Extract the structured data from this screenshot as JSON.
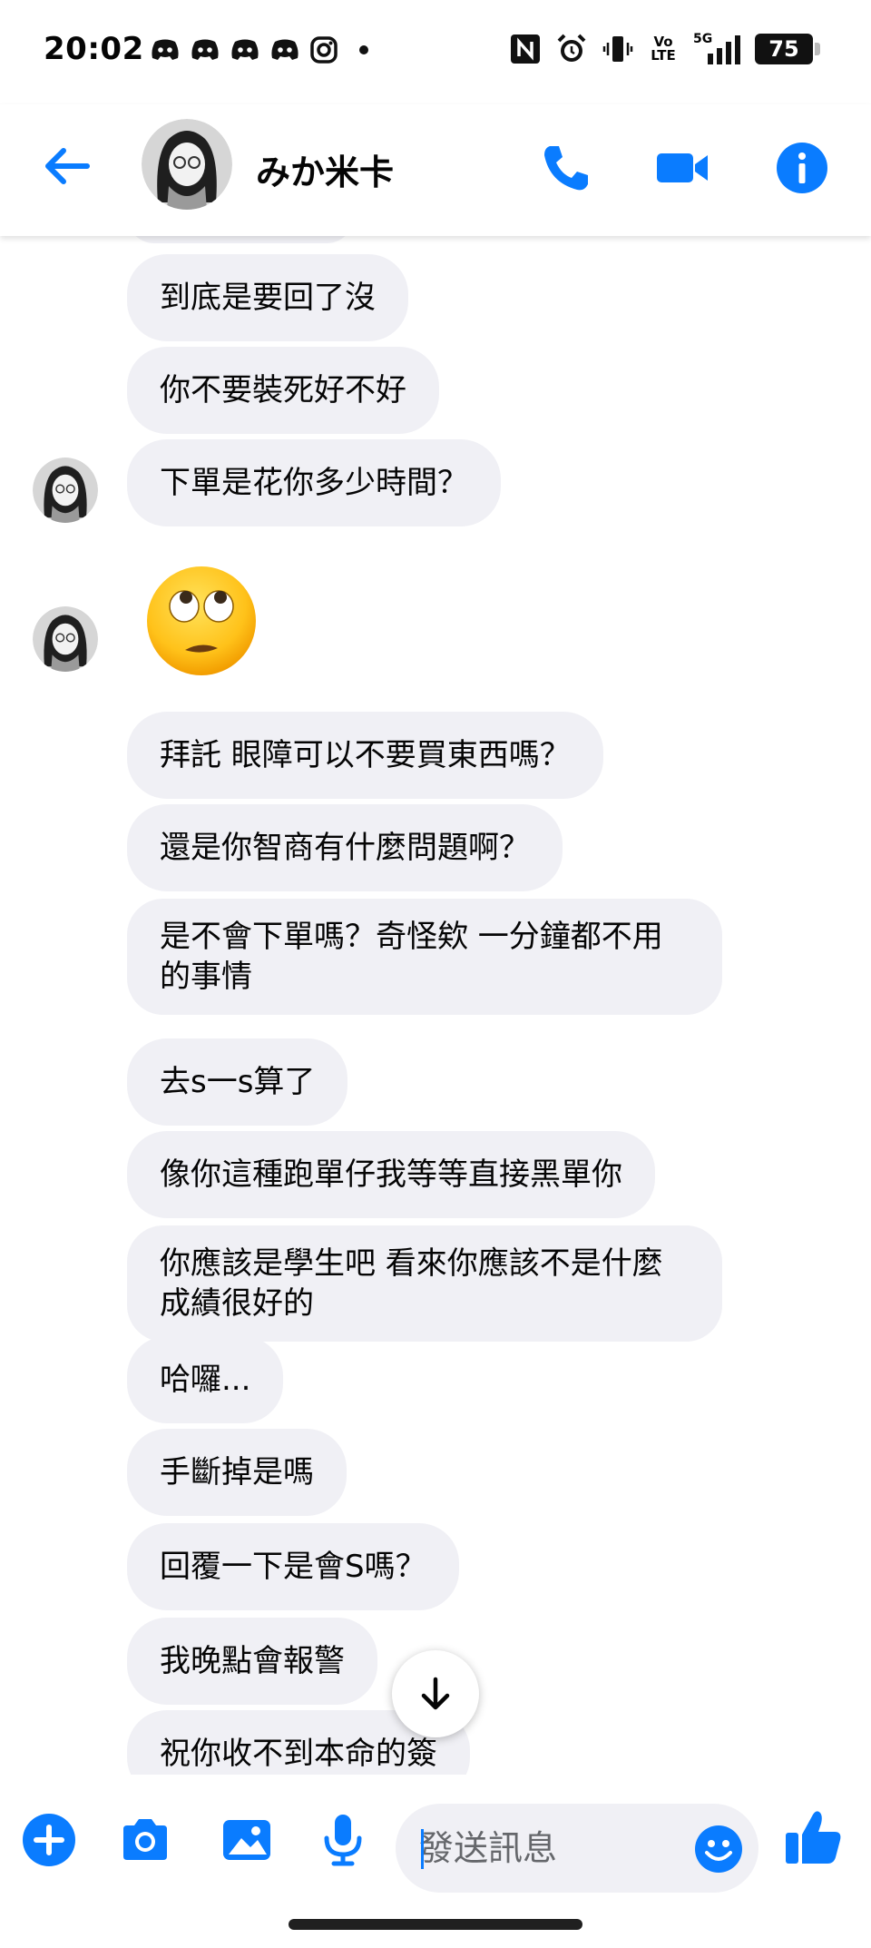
{
  "status_bar": {
    "time": "20:02",
    "battery": "75",
    "left_icons": [
      "discord-icon",
      "discord-icon",
      "discord-icon",
      "discord-icon",
      "instagram-icon",
      "dot-icon"
    ],
    "right_icons": [
      "nfc-icon",
      "alarm-icon",
      "vibrate-icon",
      "volte-icon",
      "signal-5g-icon",
      "battery-icon"
    ],
    "volte_label": "Vo LTE",
    "network_label": "5G"
  },
  "header": {
    "contact_name": "みか米卡",
    "icons": [
      "back-arrow-icon",
      "phone-icon",
      "video-call-icon",
      "info-icon"
    ]
  },
  "messages": [
    {
      "text": "到底是要回了沒"
    },
    {
      "text": "你不要裝死好不好"
    },
    {
      "text": "下單是花你多少時間？"
    },
    {
      "emoji": "eye-roll-emoji"
    },
    {
      "text": "拜託 眼障可以不要買東西嗎？"
    },
    {
      "text": "還是你智商有什麼問題啊？"
    },
    {
      "text": "是不會下單嗎？奇怪欸 一分鐘都不用的事情"
    },
    {
      "text": "去s一s算了"
    },
    {
      "text": "像你這種跑單仔我等等直接黑單你"
    },
    {
      "text": "你應該是學生吧 看來你應該不是什麼成績很好的"
    },
    {
      "text": "哈囉..."
    },
    {
      "text": "手斷掉是嗎"
    },
    {
      "text": "回覆一下是會S嗎？"
    },
    {
      "text": "我晚點會報警"
    },
    {
      "text": "祝你收不到本命的簽"
    }
  ],
  "composer": {
    "placeholder": "發送訊息",
    "value": "",
    "icons": [
      "plus-icon",
      "camera-icon",
      "gallery-icon",
      "microphone-icon",
      "emoji-icon",
      "thumbs-up-icon"
    ]
  },
  "colors": {
    "accent": "#0a7cff",
    "bubble": "#f0f0f5",
    "text": "#050505"
  }
}
